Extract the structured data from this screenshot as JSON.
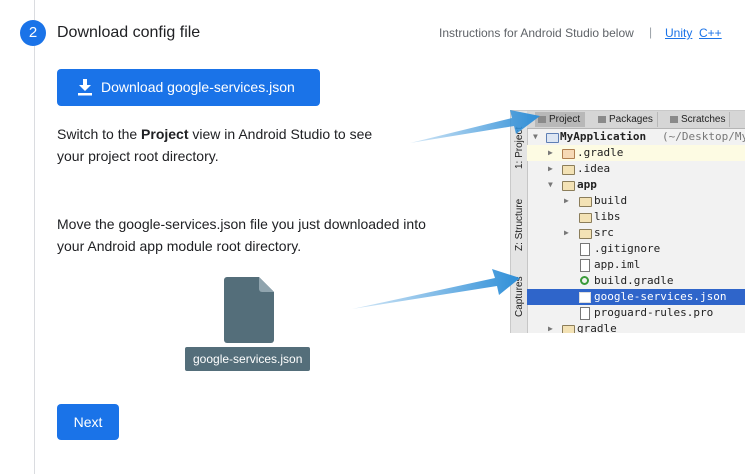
{
  "step": {
    "number": "2",
    "title": "Download config file"
  },
  "header": {
    "instructions": "Instructions for Android Studio below",
    "separator": "|",
    "link_unity": "Unity",
    "link_cpp": "C++"
  },
  "download_button": {
    "label": "Download google-services.json",
    "icon": "download-icon"
  },
  "instruction1": {
    "pre": "Switch to the ",
    "bold": "Project",
    "post": " view in Android Studio to see",
    "line2": "your project root directory."
  },
  "instruction2": {
    "line1": "Move the google-services.json file you just downloaded into",
    "line2": "your Android app module root directory."
  },
  "file": {
    "name": "google-services.json",
    "icon": "file-icon"
  },
  "next_button": {
    "label": "Next"
  },
  "android_studio": {
    "tabs": [
      "Project",
      "Packages",
      "Scratches"
    ],
    "side_tabs": [
      "1: Project",
      "Z: Structure",
      "Captures"
    ],
    "tree": [
      {
        "label": "MyApplication",
        "suffix": " (~/Desktop/My"
      },
      {
        "label": ".gradle"
      },
      {
        "label": ".idea"
      },
      {
        "label": "app"
      },
      {
        "label": "build"
      },
      {
        "label": "libs"
      },
      {
        "label": "src"
      },
      {
        "label": ".gitignore"
      },
      {
        "label": "app.iml"
      },
      {
        "label": "build.gradle"
      },
      {
        "label": "google-services.json"
      },
      {
        "label": "proguard-rules.pro"
      },
      {
        "label": "gradle"
      }
    ]
  },
  "colors": {
    "accent": "#1a73e8",
    "file_label_bg": "#546e7a",
    "arrow": "#2f8fd8",
    "selection": "#2f65ca"
  }
}
